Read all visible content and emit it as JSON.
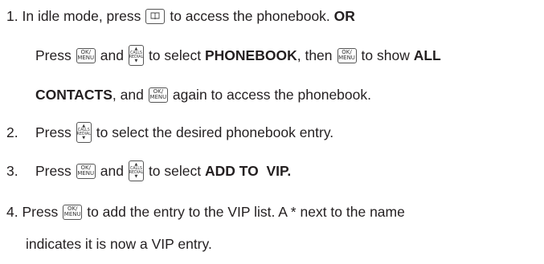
{
  "steps": [
    {
      "num": "1.",
      "t1": "In idle mode, press",
      "t2": "to access the phonebook.",
      "t3": "OR",
      "l2": [
        "Press",
        "and",
        "to select",
        "PHONEBOOK",
        ", then",
        "to show",
        "ALL"
      ],
      "l3": [
        "CONTACTS",
        ", and",
        "again to access the phonebook."
      ]
    },
    {
      "num": "2.",
      "t1": "Press",
      "t2": "to select the desired phonebook entry."
    },
    {
      "num": "3.",
      "t1": "Press",
      "t2": "and",
      "t3": "to select",
      "t4": "ADD TO  VIP."
    },
    {
      "num": "4.",
      "t1": "Press",
      "t2": "to add the entry to the VIP list. A * next to the name",
      "t3": "indicates it is now a VIP entry."
    }
  ],
  "keys": {
    "ok_menu": [
      "OK/",
      "MENU"
    ],
    "calls": "CALLS",
    "redial": "REDIAL",
    "up_arrow": "▲",
    "down_arrow": "▼",
    "phonebook_icon": "📖"
  }
}
